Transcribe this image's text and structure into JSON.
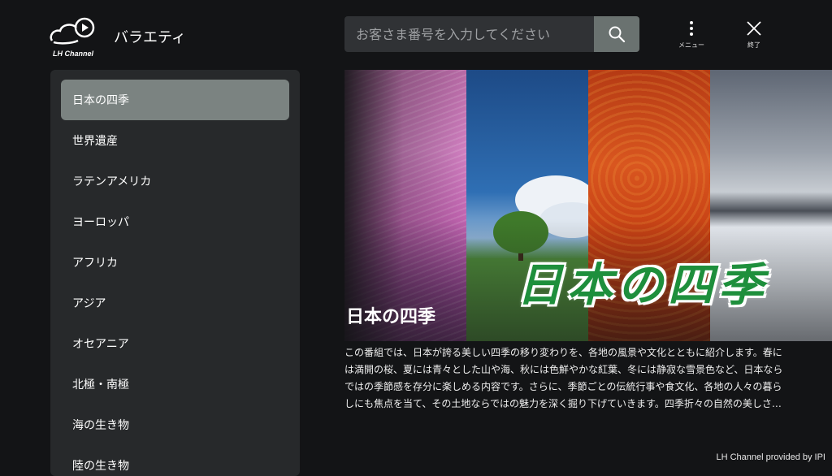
{
  "app": {
    "logo_text": "LH Channel",
    "genre_title": "バラエティ"
  },
  "search": {
    "placeholder": "お客さま番号を入力してください"
  },
  "topbar": {
    "menu_label": "メニュー",
    "exit_label": "終了"
  },
  "sidebar": {
    "selected_index": 0,
    "items": [
      {
        "label": "日本の四季"
      },
      {
        "label": "世界遺産"
      },
      {
        "label": "ラテンアメリカ"
      },
      {
        "label": "ヨーロッパ"
      },
      {
        "label": "アフリカ"
      },
      {
        "label": "アジア"
      },
      {
        "label": "オセアニア"
      },
      {
        "label": "北極・南極"
      },
      {
        "label": "海の生き物"
      },
      {
        "label": "陸の生き物"
      }
    ]
  },
  "detail": {
    "hero_logo_text": "日本の四季",
    "title": "日本の四季",
    "description": "この番組では、日本が誇る美しい四季の移り変わりを、各地の風景や文化とともに紹介します。春には満開の桜、夏には青々とした山や海、秋には色鮮やかな紅葉、冬には静寂な雪景色など、日本ならではの季節感を存分に楽しめる内容です。さらに、季節ごとの伝統行事や食文化、各地の人々の暮らしにも焦点を当て、その土地ならではの魅力を深く掘り下げていきます。四季折々の自然の美しさ…"
  },
  "footer": {
    "credit": "LH Channel provided by IPI"
  },
  "colors": {
    "background": "#131416",
    "sidebar": "#27292b",
    "selected": "#7b8381",
    "search_button": "#6a7270"
  }
}
